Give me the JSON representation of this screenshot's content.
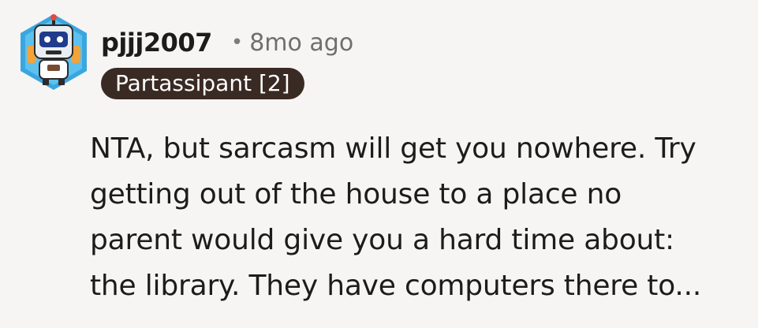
{
  "comment": {
    "avatar_icon": "robot-avatar-icon",
    "username": "pjjj2007",
    "separator": "•",
    "timestamp": "8mo ago",
    "flair": "Partassipant [2]",
    "body_lines": [
      "NTA, but sarcasm will get you nowhere. Try",
      "getting out of the house to a place no",
      "parent would give you a hard time about:",
      "the library. They have computers there to..."
    ]
  },
  "colors": {
    "background": "#f7f5f4",
    "flair_background": "#3a2a24",
    "flair_text": "#ffffff",
    "avatar_hex": "#3aa6e0",
    "meta_text": "#6f6f6f"
  }
}
